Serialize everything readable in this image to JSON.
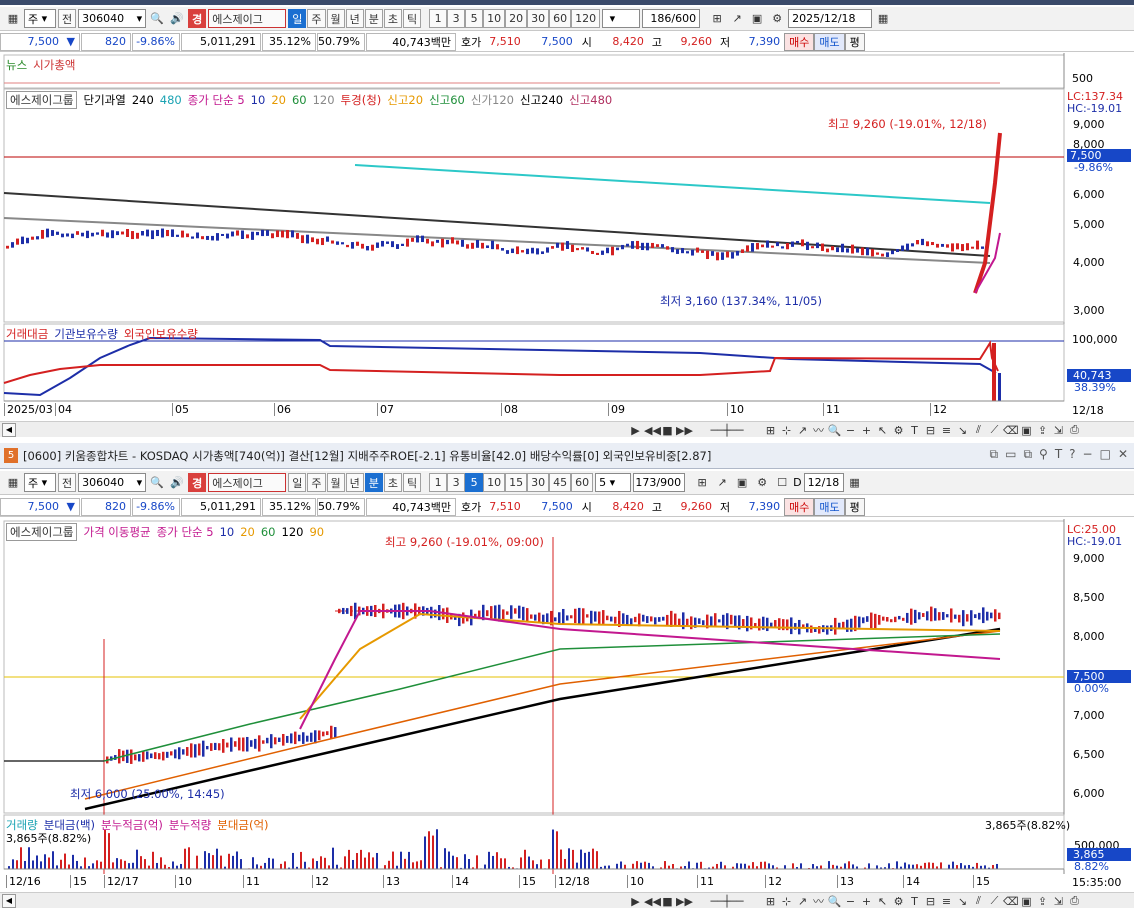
{
  "top": {
    "toolbar": {
      "period_select": "주",
      "prev_label": "전",
      "code": "306040",
      "badge": "경",
      "name": "에스제이그",
      "tabs": [
        "일",
        "주",
        "월",
        "년",
        "분",
        "초",
        "틱"
      ],
      "active_tab": "일",
      "counts": [
        "1",
        "3",
        "5",
        "10",
        "20",
        "30",
        "60",
        "120"
      ],
      "range": "186",
      "range_total": "/600",
      "date": "2025/12/18"
    },
    "quote": {
      "price": "7,500",
      "change": "820",
      "change_pct": "-9.86%",
      "volume": "5,011,291",
      "ratio1": "35.12%",
      "ratio2": "50.79%",
      "amount": "40,743백만",
      "ask_label": "호가",
      "ask1": "7,510",
      "ask2": "7,500",
      "open_label": "시",
      "open": "8,420",
      "high_label": "고",
      "high": "9,260",
      "low_label": "저",
      "low": "7,390",
      "buy": "매수",
      "sell": "매도",
      "eval": "평"
    },
    "news": {
      "label1": "뉴스",
      "label2": "시가총액",
      "axis": "500"
    },
    "legend": {
      "name": "에스제이그룹",
      "items": [
        {
          "t": "단기과열",
          "c": "#000"
        },
        {
          "t": "240",
          "c": "#000"
        },
        {
          "t": "480",
          "c": "#1ba3b3"
        },
        {
          "t": "종가 단순 5",
          "c": "#c2188f"
        },
        {
          "t": "10",
          "c": "#1d2ea8"
        },
        {
          "t": "20",
          "c": "#e69900"
        },
        {
          "t": "60",
          "c": "#1f8f3a"
        },
        {
          "t": "120",
          "c": "#888"
        },
        {
          "t": "투경(청)",
          "c": "#d42020"
        },
        {
          "t": "신고20",
          "c": "#e69900"
        },
        {
          "t": "신고60",
          "c": "#1f8f3a"
        },
        {
          "t": "신가120",
          "c": "#888"
        },
        {
          "t": "신고240",
          "c": "#000"
        },
        {
          "t": "신고480",
          "c": "#b03060"
        }
      ]
    },
    "annot_high": "최고 9,260 (-19.01%, 12/18)",
    "annot_low": "최저 3,160 (137.34%, 11/05)",
    "price_axis": [
      "9,000",
      "8,000",
      "6,000",
      "5,000",
      "4,000",
      "3,000"
    ],
    "lc": "LC:137.34",
    "hc": "HC:-19.01",
    "cur_price": "7,500",
    "cur_pct": "-9.86%",
    "vol_legend": [
      {
        "t": "거래대금",
        "c": "#d42020"
      },
      {
        "t": "기관보유수량",
        "c": "#1d2ea8"
      },
      {
        "t": "외국인보유수량",
        "c": "#d42020"
      }
    ],
    "vol_axis": "100,000",
    "vol_cur": "40,743",
    "vol_pct": "38.39%",
    "dates": [
      "2025/03",
      "04",
      "05",
      "06",
      "07",
      "08",
      "09",
      "10",
      "11",
      "12"
    ],
    "date_right": "12/18"
  },
  "bottom": {
    "title": "[0600] 키움종합차트 - KOSDAQ 시가총액[740(억)] 결산[12월] 지배주주ROE[-2.1] 유통비율[42.0] 배당수익률[0] 외국인보유비중[2.87]",
    "win_num": "5",
    "toolbar": {
      "period_select": "주",
      "prev_label": "전",
      "code": "306040",
      "badge": "경",
      "name": "에스제이그",
      "tabs": [
        "일",
        "주",
        "월",
        "년",
        "분",
        "초",
        "틱"
      ],
      "active_tab": "분",
      "counts": [
        "1",
        "3",
        "5",
        "10",
        "15",
        "30",
        "45",
        "60"
      ],
      "active_count": "5",
      "interval": "5",
      "range": "173",
      "range_total": "/900",
      "d_label": "D",
      "date": "12/18"
    },
    "legend": {
      "name": "에스제이그룹",
      "items": [
        {
          "t": "가격 이동평균",
          "c": "#c2188f"
        },
        {
          "t": "종가 단순 5",
          "c": "#c2188f"
        },
        {
          "t": "10",
          "c": "#1d2ea8"
        },
        {
          "t": "20",
          "c": "#e69900"
        },
        {
          "t": "60",
          "c": "#1f8f3a"
        },
        {
          "t": "120",
          "c": "#000"
        },
        {
          "t": "90",
          "c": "#e69900"
        }
      ]
    },
    "annot_high": "최고 9,260 (-19.01%, 09:00)",
    "annot_low": "최저 6,000 (25.00%, 14:45)",
    "price_axis": [
      "9,000",
      "8,500",
      "8,000",
      "7,000",
      "6,500",
      "6,000"
    ],
    "lc": "LC:25.00",
    "hc": "HC:-19.01",
    "cur_price": "7,500",
    "cur_pct": "0.00%",
    "vol_legend": [
      {
        "t": "거래량",
        "c": "#1ba3b3"
      },
      {
        "t": "분대금(백)",
        "c": "#1d2ea8"
      },
      {
        "t": "분누적금(억)",
        "c": "#c2188f"
      },
      {
        "t": "분누적량",
        "c": "#c2188f"
      },
      {
        "t": "분대금(억)",
        "c": "#e06000"
      }
    ],
    "vol_left": "3,865주(8.82%)",
    "vol_right": "3,865주(8.82%)",
    "vol_axis": "500,000",
    "vol_cur": "3,865",
    "vol_pct": "8.82%",
    "dates": [
      "12/16",
      "15",
      "12/17",
      "10",
      "11",
      "12",
      "13",
      "14",
      "15",
      "12/18",
      "10",
      "11",
      "12",
      "13",
      "14",
      "15"
    ],
    "time_right": "15:35:00"
  }
}
